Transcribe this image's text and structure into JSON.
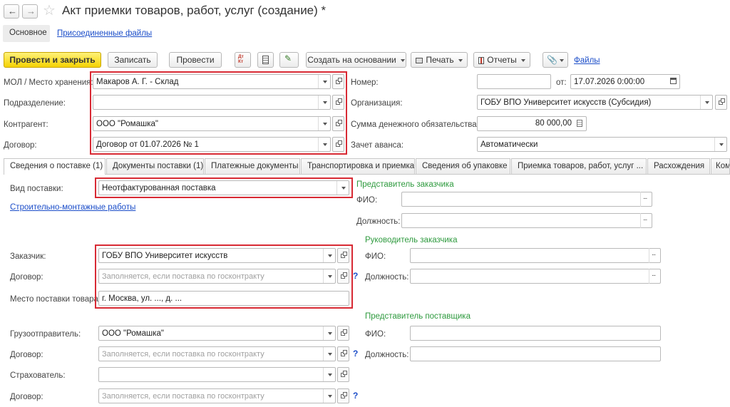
{
  "window": {
    "title": "Акт приемки товаров, работ, услуг (создание) *"
  },
  "subnav": {
    "main": "Основное",
    "attached_files": "Присоединенные файлы"
  },
  "toolbar": {
    "post_and_close": "Провести и закрыть",
    "save": "Записать",
    "post": "Провести",
    "create_based_on": "Создать на основании",
    "print": "Печать",
    "reports": "Отчеты",
    "files": "Файлы",
    "icon_dt_kt": "Дт\nКт"
  },
  "header": {
    "mol_label": "МОЛ / Место хранения:",
    "mol_value": "Макаров А. Г. - Склад",
    "dept_label": "Подразделение:",
    "dept_value": "",
    "counterparty_label": "Контрагент:",
    "counterparty_value": "ООО \"Ромашка\"",
    "contract_label": "Договор:",
    "contract_value": "Договор от 01.07.2026 № 1",
    "number_label": "Номер:",
    "number_value": "",
    "date_from_label": "от:",
    "date_value": "17.07.2026  0:00:00",
    "org_label": "Организация:",
    "org_value": "ГОБУ ВПО Университет искусств (Субсидия)",
    "amount_label": "Сумма денежного обязательства:",
    "amount_value": "80 000,00",
    "advance_label": "Зачет аванса:",
    "advance_value": "Автоматически"
  },
  "tabs": [
    {
      "label": "Сведения о поставке (1)"
    },
    {
      "label": "Документы поставки (1)"
    },
    {
      "label": "Платежные документы"
    },
    {
      "label": "Транспортировка и приемка"
    },
    {
      "label": "Сведения об упаковке"
    },
    {
      "label": "Приемка товаров, работ, услуг ..."
    },
    {
      "label": "Расхождения"
    },
    {
      "label": "Ком"
    }
  ],
  "delivery": {
    "type_label": "Вид поставки:",
    "type_value": "Неотфактурованная поставка",
    "construction_link": "Строительно-монтажные работы",
    "customer_label": "Заказчик:",
    "customer_value": "ГОБУ ВПО Университет искусств",
    "contract_label": "Договор:",
    "contract_placeholder": "Заполняется, если поставка по госконтракту",
    "place_label": "Место поставки товара:",
    "place_value": "г. Москва, ул. ..., д. ...",
    "shipper_label": "Грузоотправитель:",
    "shipper_value": "ООО \"Ромашка\"",
    "shipper_contract_label": "Договор:",
    "insurer_label": "Страхователь:",
    "insurer_value": "",
    "insurer_contract_label": "Договор:",
    "help_mark": "?"
  },
  "right": {
    "customer_rep_title": "Представитель заказчика",
    "customer_head_title": "Руководитель заказчика",
    "supplier_rep_title": "Представитель поставщика",
    "fio_label": "ФИО:",
    "position_label": "Должность:"
  },
  "colors": {
    "accent_yellow": "#f5d200",
    "highlight_red": "#d82a34",
    "group_green": "#2e9a3e",
    "link_blue": "#1c4ec9"
  }
}
